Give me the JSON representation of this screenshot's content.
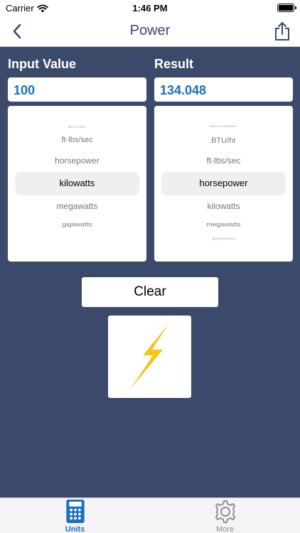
{
  "status": {
    "carrier": "Carrier",
    "time": "1:46 PM"
  },
  "nav": {
    "title": "Power"
  },
  "input": {
    "label": "Input Value",
    "value": "100"
  },
  "result": {
    "label": "Result",
    "value": "134.048"
  },
  "input_units": [
    {
      "label": "BTU/hr"
    },
    {
      "label": "ft-lbs/sec"
    },
    {
      "label": "horsepower"
    },
    {
      "label": "kilowatts",
      "selected": true
    },
    {
      "label": "megawatts"
    },
    {
      "label": "gigawatts"
    }
  ],
  "result_units": [
    {
      "label": "kiloCal/sec"
    },
    {
      "label": "BTU/hr"
    },
    {
      "label": "ft-lbs/sec"
    },
    {
      "label": "horsepower",
      "selected": true
    },
    {
      "label": "kilowatts"
    },
    {
      "label": "megawatts"
    },
    {
      "label": "gigawatts"
    }
  ],
  "clear_label": "Clear",
  "tabs": [
    {
      "label": "Units",
      "icon": "calculator-icon",
      "active": true
    },
    {
      "label": "More",
      "icon": "gear-icon",
      "active": false
    }
  ],
  "colors": {
    "background": "#3b4a6b",
    "accent": "#1b6fbe",
    "bolt": "#f5c518"
  }
}
